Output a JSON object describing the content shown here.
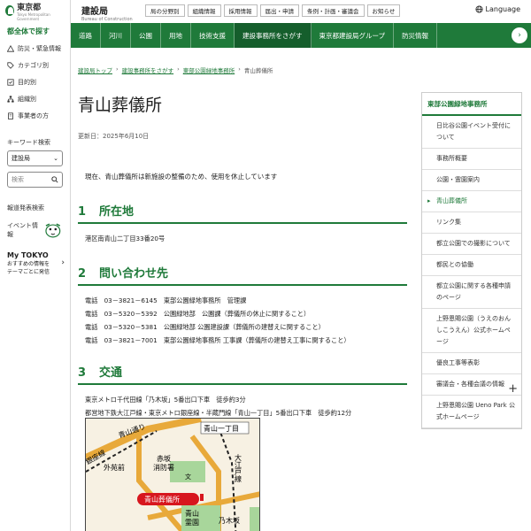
{
  "logo": {
    "name": "東京都",
    "sub": "Tokyo Metropolitan Government"
  },
  "sidebar": {
    "title": "都全体で探す",
    "items": [
      {
        "label": "防災・緊急情報",
        "icon": "warning-icon"
      },
      {
        "label": "カテゴリ別",
        "icon": "tag-icon"
      },
      {
        "label": "目的別",
        "icon": "check-list-icon"
      },
      {
        "label": "組織別",
        "icon": "org-chart-icon"
      },
      {
        "label": "事業者の方",
        "icon": "building-icon"
      }
    ],
    "keyword_label": "キーワード検索",
    "select_value": "建設局",
    "search_placeholder": "検索",
    "press_release": "報道発表検索",
    "events": "イベント情報",
    "mytokyo_title": "My TOKYO",
    "mytokyo_text1": "おすすめの情報を",
    "mytokyo_text2": "テーマごとに発信"
  },
  "header": {
    "site_name": "建設局",
    "site_en": "Bureau of Construction",
    "links": [
      "局の分野別",
      "組織情報",
      "採用情報",
      "届出・申請",
      "条例・計画・審議会",
      "お知らせ"
    ],
    "language": "Language"
  },
  "mainnav": {
    "items": [
      "道路",
      "河川",
      "公園",
      "用地",
      "技術支援",
      "建設事務所をさがす",
      "東京都建設局グループ",
      "防災情報"
    ],
    "active_index": 5
  },
  "breadcrumb": [
    "建設局トップ",
    "建設事務所をさがす",
    "東部公園緑地事務所",
    "青山葬儀所"
  ],
  "page": {
    "title": "青山葬儀所",
    "updated": "更新日：2025年6月10日",
    "intro": "現在、青山葬儀所は新施設の整備のため、使用を休止しています",
    "sections": [
      {
        "num": "1",
        "title": "所在地",
        "lines": [
          "港区南青山二丁目33番20号"
        ]
      },
      {
        "num": "2",
        "title": "問い合わせ先",
        "lines": [
          "電話　03－3821－6145　東部公園緑地事務所　管理課",
          "電話　03－5320－5392　公園緑地部　公園課（葬儀所の休止に関すること）",
          "電話　03－5320－5381　公園緑地部 公園建設課（葬儀所の建替えに関すること）",
          "電話　03－3821－7001　東部公園緑地事務所 工事課（葬儀所の建替え工事に関すること）"
        ]
      },
      {
        "num": "3",
        "title": "交通",
        "lines": [
          "東京メトロ千代田線「乃木坂」5番出口下車　徒歩約3分",
          "都営地下鉄大江戸線・東京メトロ銀座線・半蔵門線「青山一丁目」5番出口下車　徒歩約12分"
        ]
      }
    ]
  },
  "map": {
    "labels": {
      "aoyama_itchome": "青山一丁目",
      "aoyama_dori": "青山通り",
      "ginza_line": "銀座線",
      "gaienmae": "外苑前",
      "akasaka_fire": "赤坂",
      "akasaka_fire2": "消防署",
      "oedo_line": "大江戸線",
      "funeral_hall": "青山葬儀所",
      "aoyama_cemetery": "青山",
      "aoyama_cemetery2": "霊園",
      "nogizaka": "乃木坂",
      "school_mark": "文"
    }
  },
  "rightbar": {
    "title": "東部公園緑地事務所",
    "items": [
      "日比谷公園イベント受付について",
      "事務所概要",
      "公園・霊園案内",
      "青山葬儀所",
      "リンク集",
      "都立公園での撮影について",
      "都民との協働",
      "都立公園に関する各種申請のページ",
      "上野恩賜公園（うえのおんしこうえん）公式ホームページ",
      "優良工事等表彰",
      "審議会・各種会議の情報",
      "上野恩賜公園 Ueno Park 公式ホームページ"
    ],
    "active_index": 3
  },
  "colors": {
    "brand": "#1f7a3a",
    "brand_dark": "#155e2c",
    "map_bg": "#f7f1e3",
    "map_road": "#e8a93a",
    "map_label": "#d7161e"
  }
}
